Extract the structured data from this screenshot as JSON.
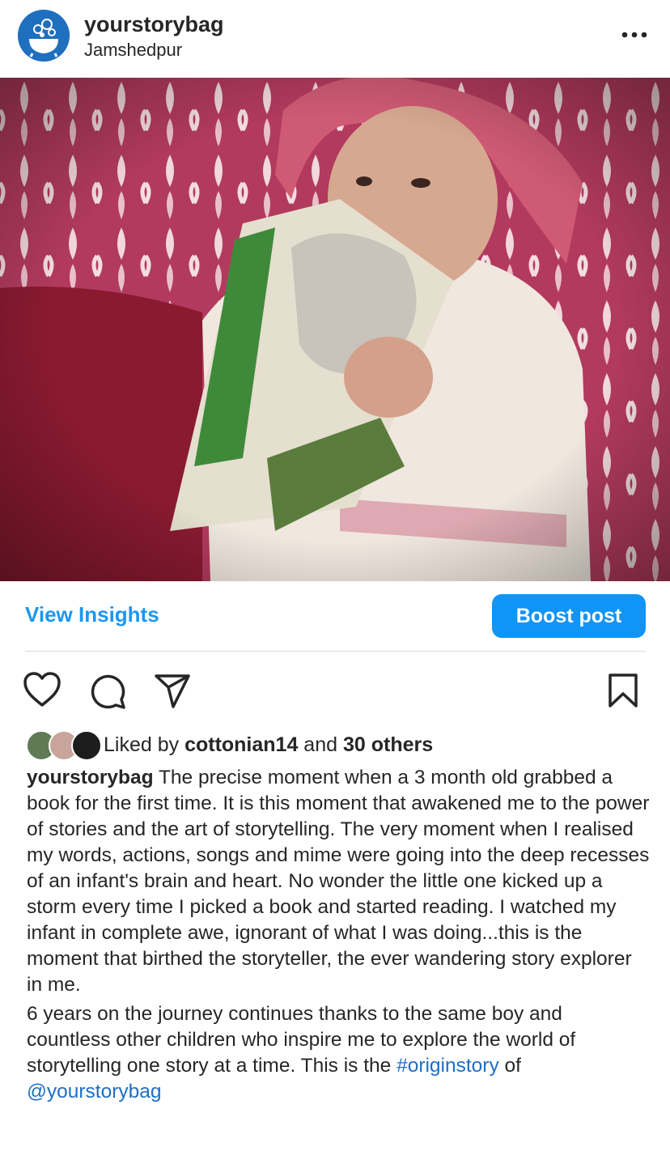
{
  "post": {
    "username": "yourstorybag",
    "location": "Jamshedpur",
    "more_icon": "ellipsis-icon"
  },
  "actions": {
    "view_insights": "View Insights",
    "boost_post": "Boost post",
    "icons": [
      "heart-icon",
      "comment-icon",
      "share-icon",
      "bookmark-icon"
    ]
  },
  "likes": {
    "prefix": "Liked by ",
    "user": "cottonian14",
    "middle": " and ",
    "others": "30 others"
  },
  "caption": {
    "username": "yourstorybag",
    "paragraph1": "The precise moment when a 3 month old grabbed a book for the first time. It is this moment that awakened me to the power of stories and the art of storytelling. The very moment when I realised my words, actions, songs and mime were going into the deep recesses of an infant's brain and heart. No wonder the little one kicked up a storm every time I picked a book and started reading. I watched my infant in complete awe, ignorant of what I was doing...this is the moment  that birthed the storyteller, the ever wandering story explorer in me.",
    "paragraph2": "6 years on the journey continues thanks to the same boy and countless other children who inspire me to explore the world of storytelling one story at a time. This is the ",
    "hashtag": "#originstory",
    "joiner": " of ",
    "mention": "@yourstorybag"
  },
  "colors": {
    "link": "#1c97f0",
    "boost_bg": "#0f95f6",
    "text": "#262626"
  }
}
